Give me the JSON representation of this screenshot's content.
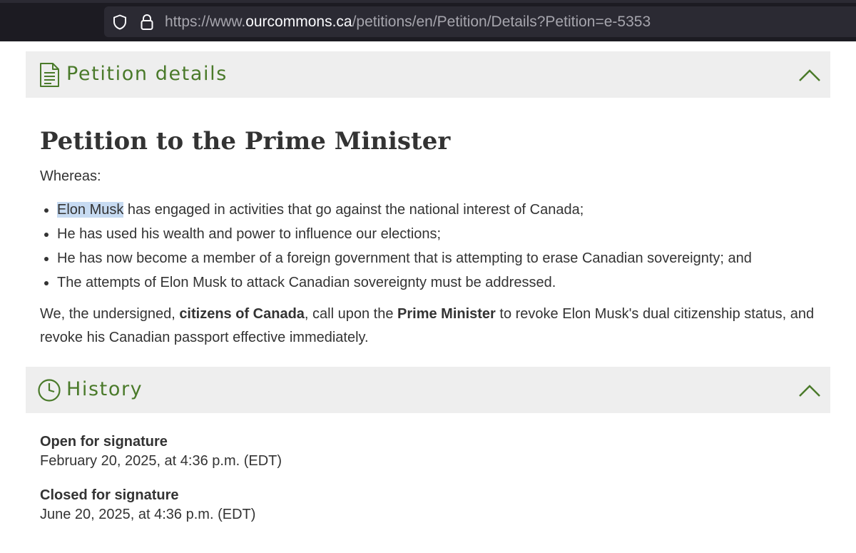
{
  "browser": {
    "url_prefix": "https://www.",
    "url_domain": "ourcommons.ca",
    "url_path": "/petitions/en/Petition/Details?Petition=e-5353"
  },
  "details_section": {
    "title": "Petition details",
    "icon": "document-icon",
    "collapse_icon": "chevron-up-icon"
  },
  "petition": {
    "title": "Petition to the Prime Minister",
    "whereas": "Whereas:",
    "bullets": {
      "b1_highlight": "Elon Musk",
      "b1_rest": " has engaged in activities that go against the national interest of Canada;",
      "b2": "He has used his wealth and power to influence our elections;",
      "b3": "He has now become a member of a foreign government that is attempting to erase Canadian sovereignty; and",
      "b4": "The attempts of Elon Musk to attack Canadian sovereignty must be addressed."
    },
    "prayer": {
      "p1": "We, the undersigned, ",
      "b1": "citizens of Canada",
      "p2": ", call upon the ",
      "b2": "Prime Minister",
      "p3": " to revoke Elon Musk's dual citizenship status, and revoke his Canadian passport effective immediately."
    }
  },
  "history_section": {
    "title": "History",
    "icon": "clock-icon",
    "collapse_icon": "chevron-up-icon",
    "open_label": "Open for signature",
    "open_value": "February 20, 2025, at 4:36 p.m. (EDT)",
    "closed_label": "Closed for signature",
    "closed_value": "June 20, 2025, at 4:36 p.m. (EDT)"
  },
  "colors": {
    "accent_green": "#4a7a2a",
    "header_bg": "#eeeeee",
    "browser_bg": "#1c1b22",
    "highlight": "#c7dbf2"
  }
}
